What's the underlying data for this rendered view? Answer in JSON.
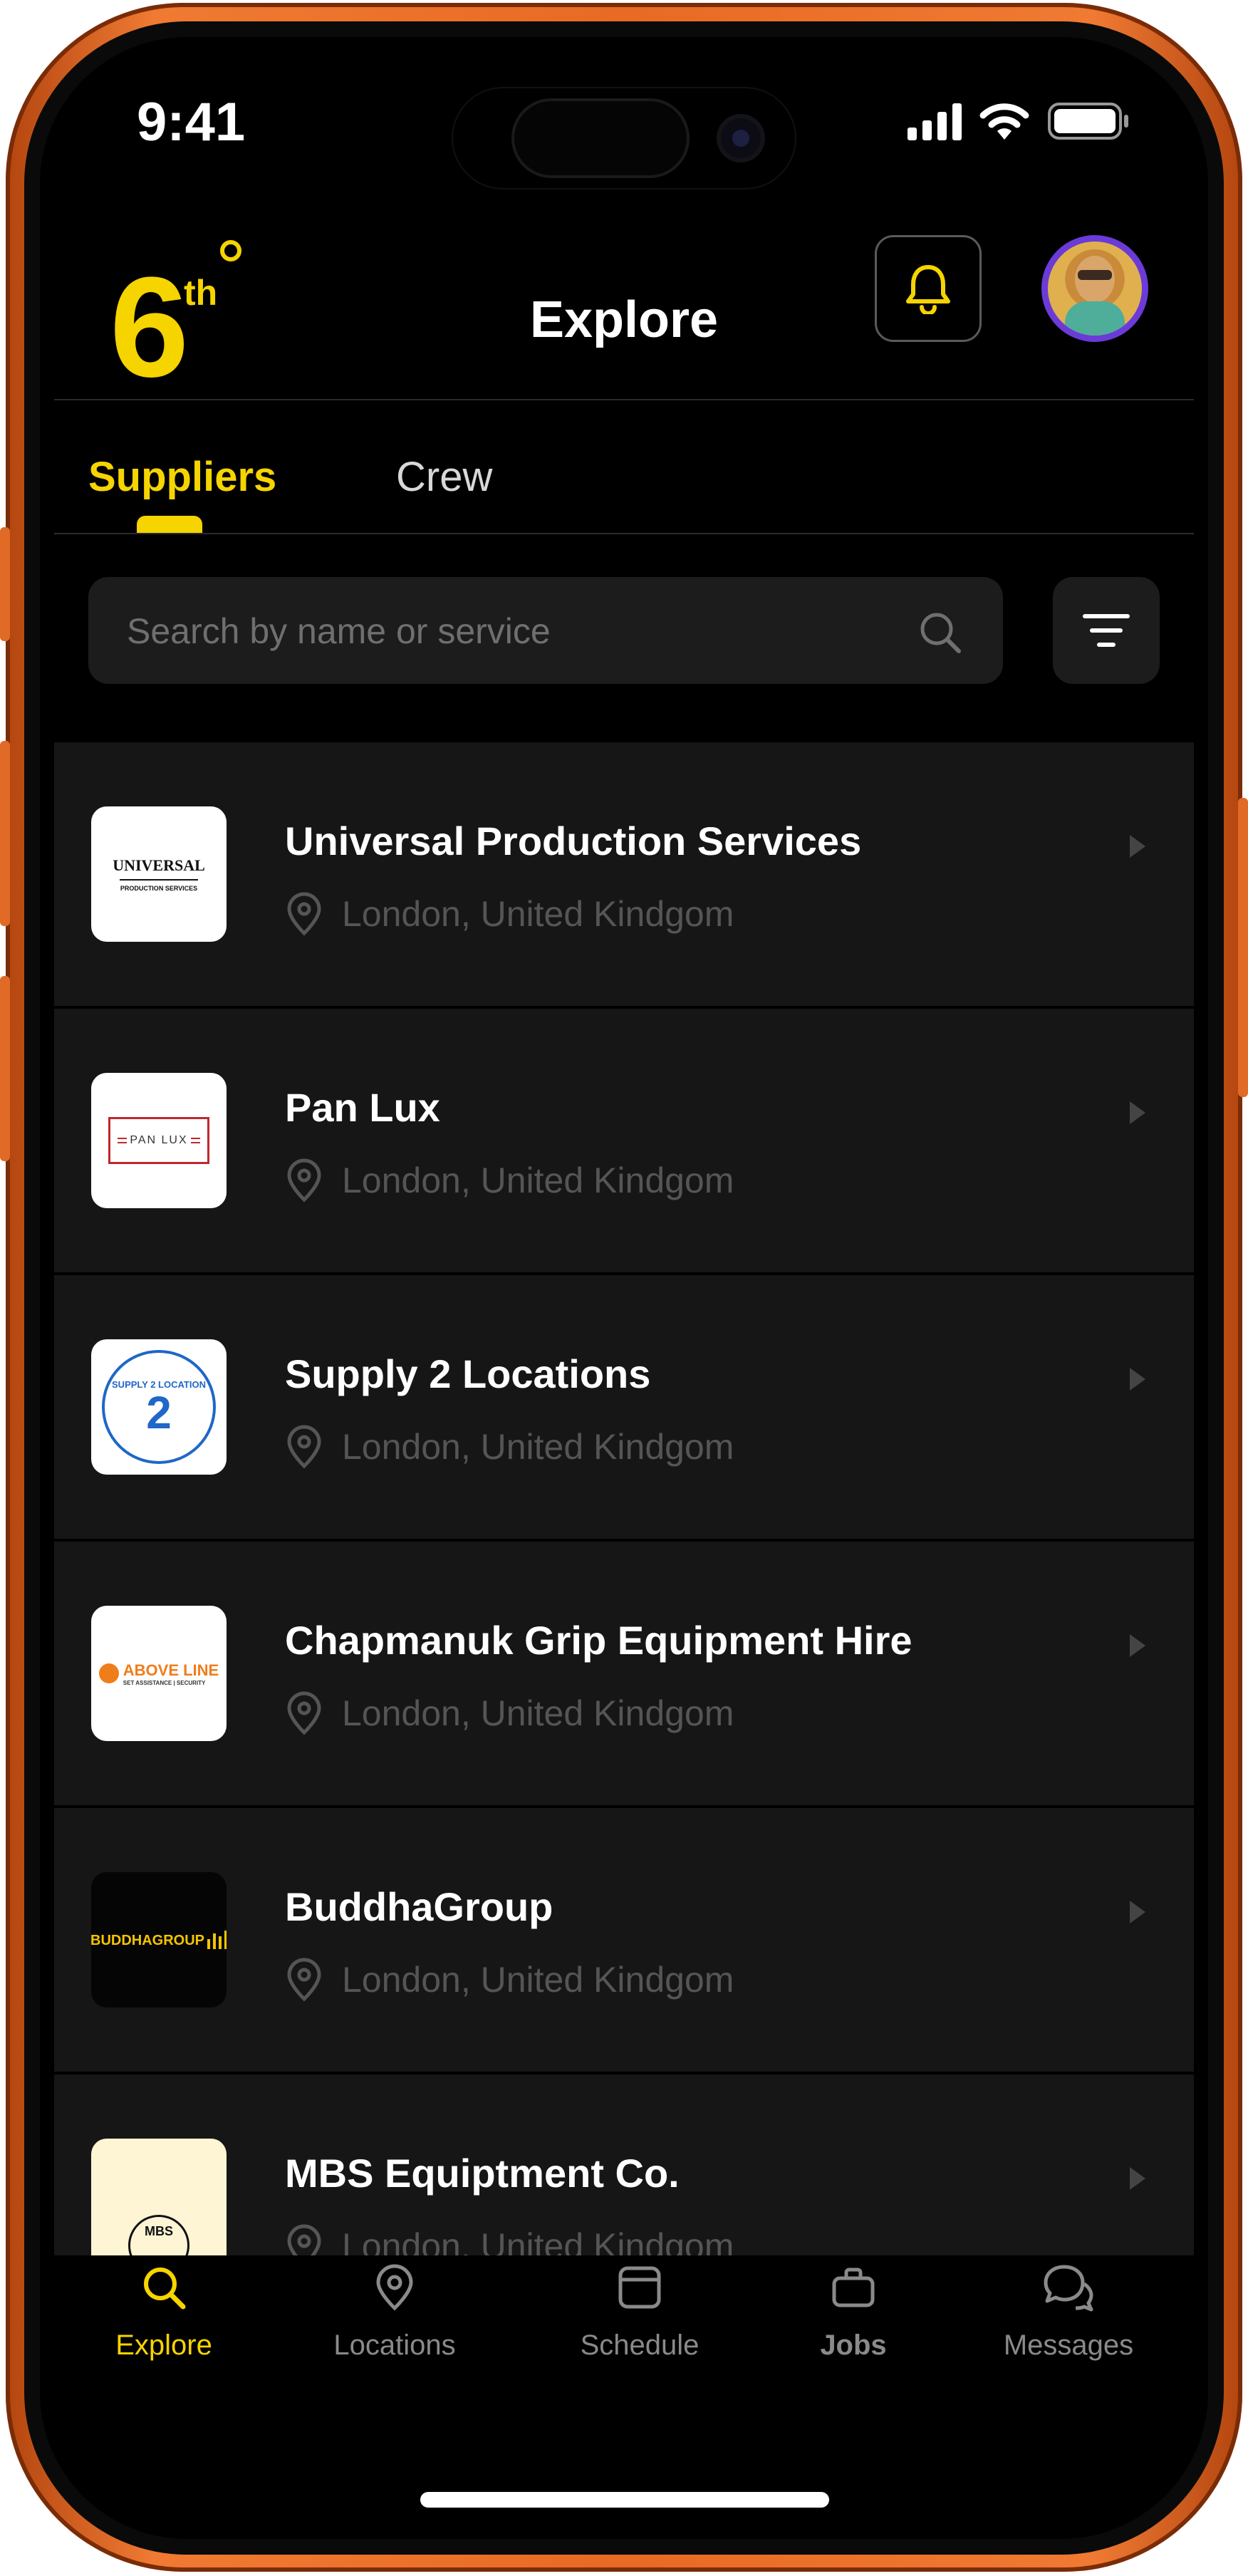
{
  "status": {
    "time": "9:41"
  },
  "brand": {
    "logo_text": "6",
    "logo_sup": "th"
  },
  "header": {
    "title": "Explore"
  },
  "tabs": {
    "suppliers": "Suppliers",
    "crew": "Crew",
    "active": "suppliers"
  },
  "search": {
    "placeholder": "Search by name or service",
    "value": ""
  },
  "suppliers": [
    {
      "name": "Universal Production Services",
      "location": "London, United Kindgom",
      "logo_text": "UNIVERSAL",
      "logo_sub": "PRODUCTION SERVICES"
    },
    {
      "name": "Pan Lux",
      "location": "London, United Kindgom",
      "logo_text": "PAN LUX",
      "logo_sub": ""
    },
    {
      "name": "Supply 2 Locations",
      "location": "London, United Kindgom",
      "logo_text": "SUPPLY 2 LOCATION",
      "logo_sub": ""
    },
    {
      "name": "Chapmanuk Grip Equipment Hire",
      "location": "London, United Kindgom",
      "logo_text": "ABOVE LINE",
      "logo_sub": "SET ASSISTANCE | SECURITY"
    },
    {
      "name": "BuddhaGroup",
      "location": "London, United Kindgom",
      "logo_text": "BUDDHAGROUP",
      "logo_sub": ""
    },
    {
      "name": "MBS Equiptment Co.",
      "location": "London, United Kindgom",
      "logo_text": "MBS",
      "logo_sub": ""
    }
  ],
  "nav": {
    "explore": "Explore",
    "locations": "Locations",
    "schedule": "Schedule",
    "jobs": "Jobs",
    "messages": "Messages",
    "active": "explore"
  },
  "colors": {
    "accent": "#f5d400",
    "frame": "#e86a24",
    "avatar_ring": "#6b3bd8"
  }
}
